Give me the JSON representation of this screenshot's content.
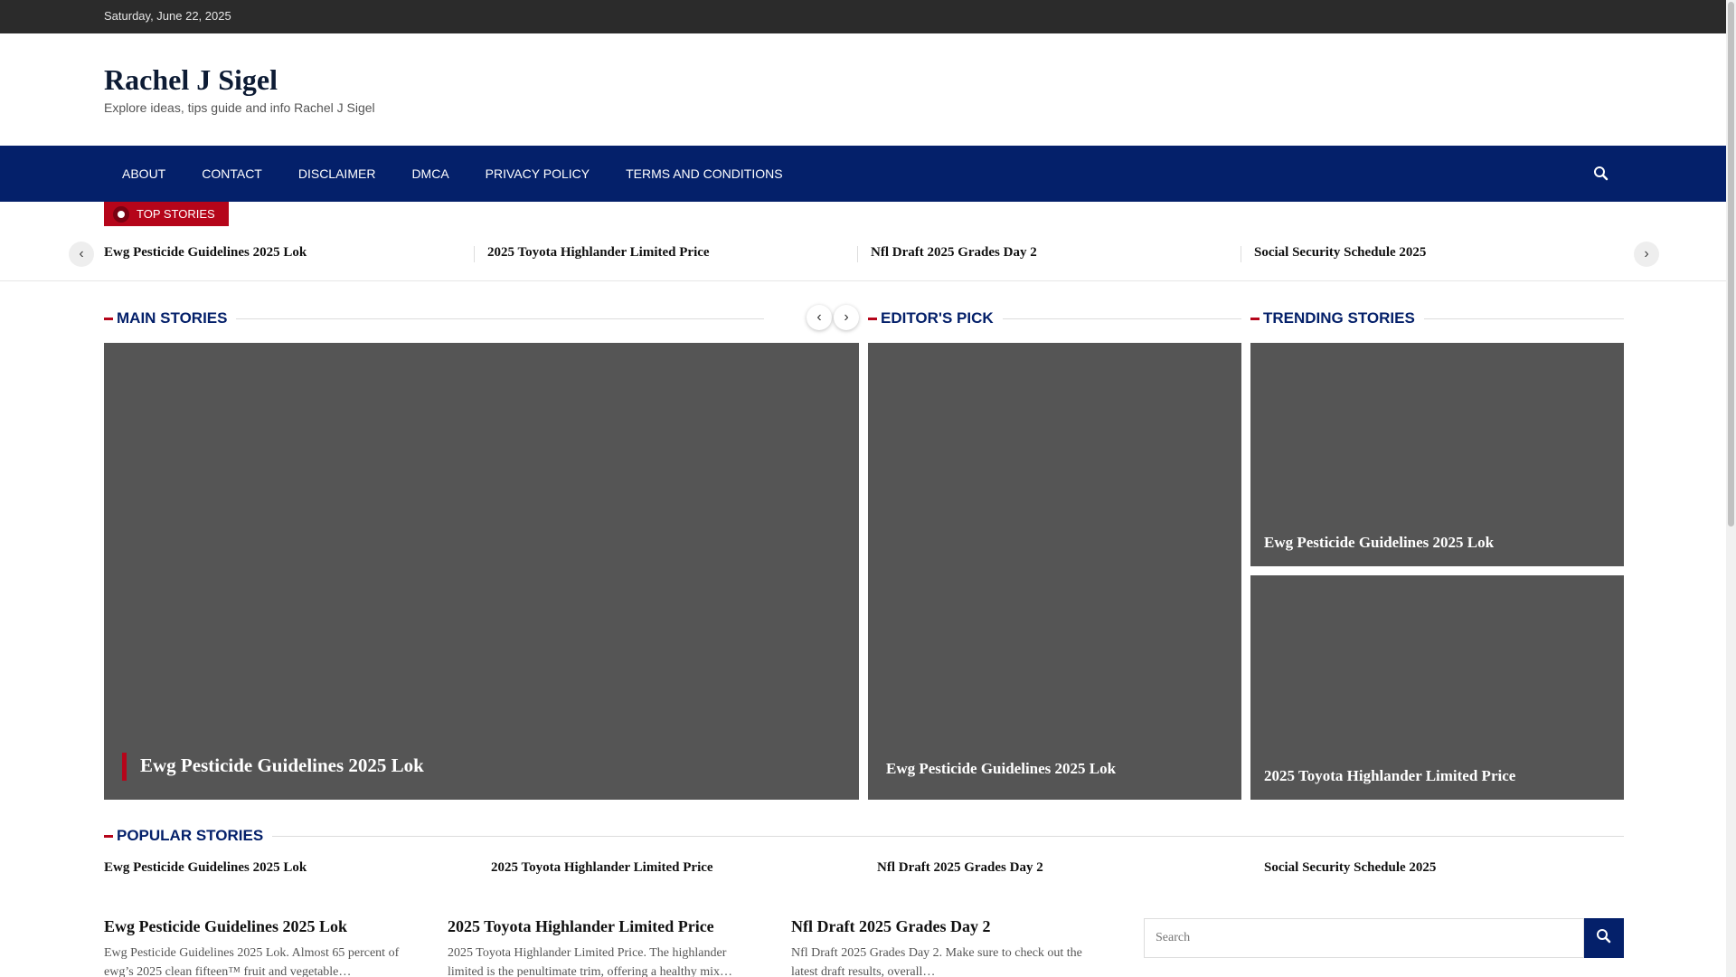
{
  "topbar": {
    "date": "Saturday, June 22, 2025"
  },
  "site": {
    "title": "Rachel J Sigel",
    "tagline": "Explore ideas, tips guide and info Rachel J Sigel"
  },
  "nav": {
    "items": [
      "ABOUT",
      "CONTACT",
      "DISCLAIMER",
      "DMCA",
      "PRIVACY POLICY",
      "TERMS AND CONDITIONS"
    ],
    "search_icon": "search-icon"
  },
  "top_stories": {
    "label": "TOP STORIES",
    "items": [
      "Ewg Pesticide Guidelines 2025 Lok",
      "2025 Toyota Highlander Limited Price",
      "Nfl Draft 2025 Grades Day 2",
      "Social Security Schedule 2025"
    ]
  },
  "main_stories": {
    "heading": "MAIN STORIES",
    "featured_title": "Ewg Pesticide Guidelines 2025 Lok"
  },
  "editors_pick": {
    "heading": "EDITOR'S PICK",
    "title": "Ewg Pesticide Guidelines 2025 Lok"
  },
  "trending": {
    "heading": "TRENDING STORIES",
    "items": [
      "Ewg Pesticide Guidelines 2025 Lok",
      "2025 Toyota Highlander Limited Price"
    ]
  },
  "popular": {
    "heading": "POPULAR STORIES",
    "items": [
      "Ewg Pesticide Guidelines 2025 Lok",
      "2025 Toyota Highlander Limited Price",
      "Nfl Draft 2025 Grades Day 2",
      "Social Security Schedule 2025"
    ]
  },
  "posts": [
    {
      "title": "Ewg Pesticide Guidelines 2025 Lok",
      "excerpt": "Ewg Pesticide Guidelines 2025 Lok. Almost 65 percent of ewg’s 2025 clean fifteen™ fruit and vegetable…"
    },
    {
      "title": "2025 Toyota Highlander Limited Price",
      "excerpt": "2025 Toyota Highlander Limited Price. The highlander limited is the penultimate trim, offering a healthy mix…"
    },
    {
      "title": "Nfl Draft 2025 Grades Day 2",
      "excerpt": "Nfl Draft 2025 Grades Day 2. Make sure to check out the latest draft results, overall…"
    }
  ],
  "sidebar_search": {
    "placeholder": "Search"
  },
  "colors": {
    "nav_bg": "#04206a",
    "accent": "#b5051a",
    "topbar_bg": "#2b2b2b",
    "card_bg": "#555555"
  }
}
